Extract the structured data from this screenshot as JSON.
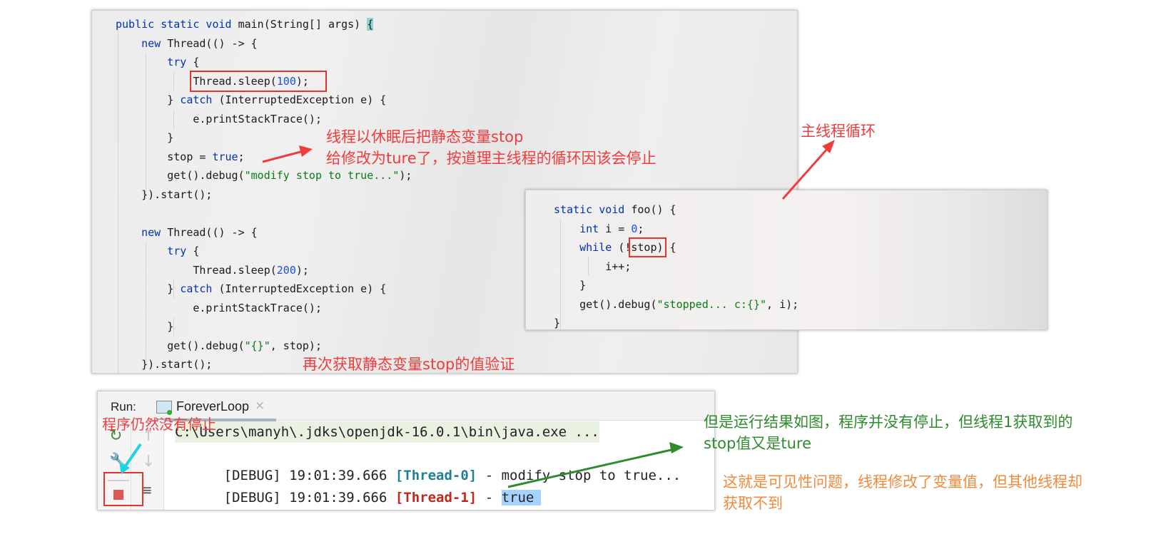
{
  "main_code": {
    "lines": [
      [
        {
          "t": "public static void ",
          "c": "kw"
        },
        {
          "t": "main(String[] args) ",
          "c": ""
        },
        {
          "t": "{",
          "c": "brace-hl"
        }
      ],
      [
        {
          "t": "    new ",
          "c": "kw"
        },
        {
          "t": "Thread(() -> {",
          "c": ""
        }
      ],
      [
        {
          "t": "        try ",
          "c": "kw"
        },
        {
          "t": "{",
          "c": ""
        }
      ],
      [
        {
          "t": "            Thread.sleep(",
          "c": ""
        },
        {
          "t": "100",
          "c": "num"
        },
        {
          "t": ");",
          "c": ""
        }
      ],
      [
        {
          "t": "        } ",
          "c": ""
        },
        {
          "t": "catch ",
          "c": "kw"
        },
        {
          "t": "(InterruptedException e) {",
          "c": ""
        }
      ],
      [
        {
          "t": "            e.printStackTrace();",
          "c": ""
        }
      ],
      [
        {
          "t": "        }",
          "c": ""
        }
      ],
      [
        {
          "t": "        stop = ",
          "c": ""
        },
        {
          "t": "true",
          "c": "kw"
        },
        {
          "t": ";",
          "c": ""
        }
      ],
      [
        {
          "t": "        get().debug(",
          "c": ""
        },
        {
          "t": "\"modify stop to true...\"",
          "c": "str"
        },
        {
          "t": ");",
          "c": ""
        }
      ],
      [
        {
          "t": "    }).start();",
          "c": ""
        }
      ],
      [
        {
          "t": "",
          "c": ""
        }
      ],
      [
        {
          "t": "    new ",
          "c": "kw"
        },
        {
          "t": "Thread(() -> {",
          "c": ""
        }
      ],
      [
        {
          "t": "        try ",
          "c": "kw"
        },
        {
          "t": "{",
          "c": ""
        }
      ],
      [
        {
          "t": "            Thread.sleep(",
          "c": ""
        },
        {
          "t": "200",
          "c": "num"
        },
        {
          "t": ");",
          "c": ""
        }
      ],
      [
        {
          "t": "        } ",
          "c": ""
        },
        {
          "t": "catch ",
          "c": "kw"
        },
        {
          "t": "(InterruptedException e) {",
          "c": ""
        }
      ],
      [
        {
          "t": "            e.printStackTrace();",
          "c": ""
        }
      ],
      [
        {
          "t": "        }",
          "c": ""
        }
      ],
      [
        {
          "t": "        get().debug(",
          "c": ""
        },
        {
          "t": "\"{}\"",
          "c": "str"
        },
        {
          "t": ", stop);",
          "c": ""
        }
      ],
      [
        {
          "t": "    }).start();",
          "c": ""
        }
      ]
    ]
  },
  "foo_code": {
    "lines": [
      [
        {
          "t": "static void ",
          "c": "kw"
        },
        {
          "t": "foo() {",
          "c": ""
        }
      ],
      [
        {
          "t": "    int ",
          "c": "kw"
        },
        {
          "t": "i = ",
          "c": ""
        },
        {
          "t": "0",
          "c": "num"
        },
        {
          "t": ";",
          "c": ""
        }
      ],
      [
        {
          "t": "    while ",
          "c": "kw"
        },
        {
          "t": "(!stop) {",
          "c": ""
        }
      ],
      [
        {
          "t": "        i++;",
          "c": ""
        }
      ],
      [
        {
          "t": "    }",
          "c": ""
        }
      ],
      [
        {
          "t": "    get().debug(",
          "c": ""
        },
        {
          "t": "\"stopped... c:{}\"",
          "c": "str"
        },
        {
          "t": ", i);",
          "c": ""
        }
      ],
      [
        {
          "t": "}",
          "c": ""
        }
      ]
    ]
  },
  "annotations": {
    "sleep_note_line1": "线程以休眠后把静态变量stop",
    "sleep_note_line2": "给修改为ture了，按道理主线程的循环因该会停止",
    "main_loop_note": "主线程循环",
    "reread_note": "再次获取静态变量stop的值验证",
    "still_running_note": "程序仍然没有停止",
    "result_note_line1": "但是运行结果如图，程序并没有停止，但线程1获取到的",
    "result_note_line2": "stop值又是ture",
    "visibility_note_line1": "这就是可见性问题，线程修改了变量值，但其他线程却",
    "visibility_note_line2": "获取不到"
  },
  "run_panel": {
    "label": "Run:",
    "tab_name": "ForeverLoop",
    "tab_close": "×",
    "toolbar_icons": [
      "rerun-icon",
      "up-arrow-icon",
      "wrench-icon",
      "down-arrow-icon",
      "stop-icon",
      "soft-wrap-icon"
    ],
    "console": {
      "command": "C:\\Users\\manyh\\.jdks\\openjdk-16.0.1\\bin\\java.exe ...",
      "lines": [
        {
          "prefix": "[DEBUG] 19:01:39.666 ",
          "thread": "[Thread-0]",
          "sep": " - ",
          "msg": "modify stop to true..."
        },
        {
          "prefix": "[DEBUG] 19:01:39.666 ",
          "thread": "[Thread-1]",
          "sep": " - ",
          "msg": "true"
        }
      ]
    }
  },
  "colors": {
    "annotation_red": "#f03c3c",
    "annotation_green": "#2e8b2e",
    "annotation_orange": "#f08a3c",
    "arrow_cyan": "#1fd3e0",
    "keyword": "#0033b3",
    "string": "#067d17",
    "number": "#1750eb"
  }
}
